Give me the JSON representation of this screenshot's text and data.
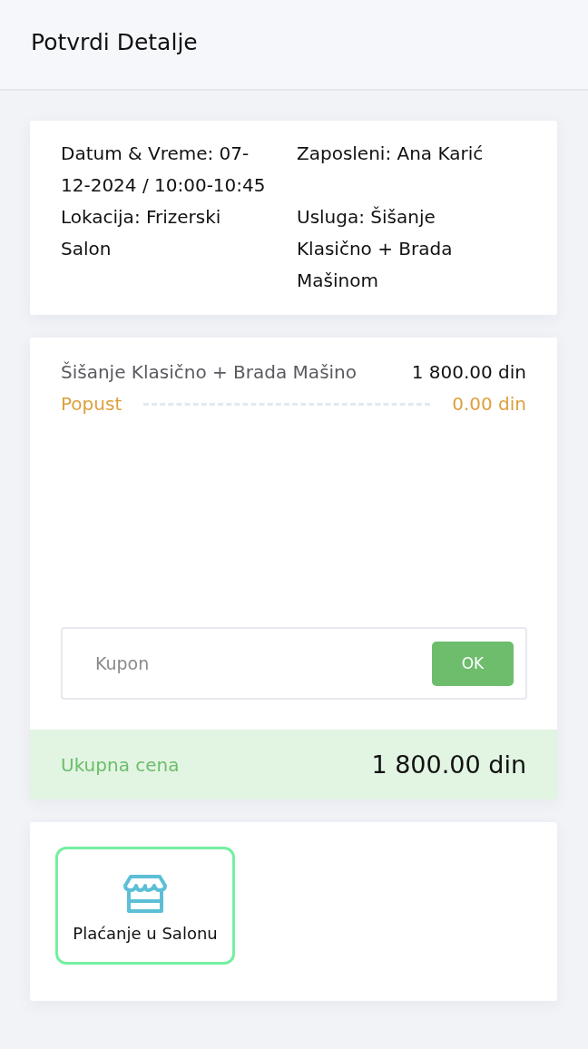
{
  "header": {
    "title": "Potvrdi Detalje"
  },
  "details": [
    "Datum & Vreme: 07-12-2024 / 10:00-10:45",
    "Zaposleni: Ana Karić",
    "Lokacija: Frizerski Salon",
    "Usluga: Šišanje Klasično + Brada Mašinom"
  ],
  "price_lines": [
    {
      "kind": "item",
      "label": "Šišanje Klasično + Brada Mašino",
      "amount": "1 800.00 din"
    },
    {
      "kind": "discount",
      "label": "Popust",
      "amount": "0.00 din"
    }
  ],
  "coupon": {
    "placeholder": "Kupon",
    "button": "OK"
  },
  "total": {
    "label": "Ukupna cena",
    "amount": "1 800.00 din"
  },
  "payment_options": [
    {
      "label": "Plaćanje u Salonu",
      "selected": true
    }
  ]
}
